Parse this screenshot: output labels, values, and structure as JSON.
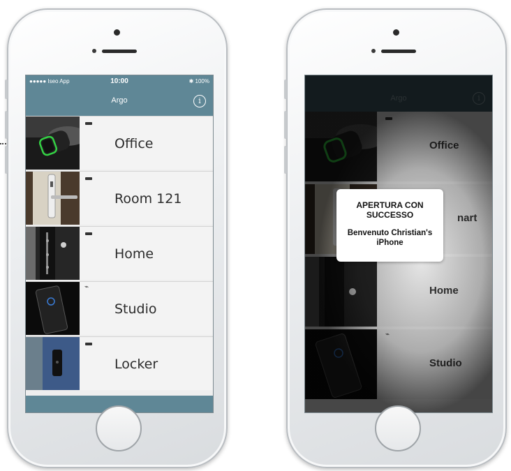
{
  "left_phone": {
    "status": {
      "carrier": "●●●●● Iseo App",
      "time": "10:00",
      "battery": "✱ 100%"
    },
    "nav": {
      "title": "Argo",
      "info_glyph": "i"
    },
    "rows": [
      {
        "label": "Office",
        "indicator": "battery-icon"
      },
      {
        "label": "Room 121",
        "indicator": "battery-icon"
      },
      {
        "label": "Home",
        "indicator": "battery-icon"
      },
      {
        "label": "Studio",
        "indicator": "charging-icon",
        "indicator_glyph": "⌁"
      },
      {
        "label": "Locker",
        "indicator": "battery-icon"
      }
    ]
  },
  "right_phone": {
    "nav": {
      "title": "Argo",
      "info_glyph": "i"
    },
    "rows": [
      {
        "label": "Office"
      },
      {
        "label": "nart"
      },
      {
        "label": "Home"
      },
      {
        "label": "Studio",
        "indicator_glyph": "⌁"
      }
    ],
    "alert": {
      "title": "APERTURA CON SUCCESSO",
      "message": "Benvenuto Christian's iPhone"
    }
  },
  "colors": {
    "accent": "#5f8796"
  }
}
